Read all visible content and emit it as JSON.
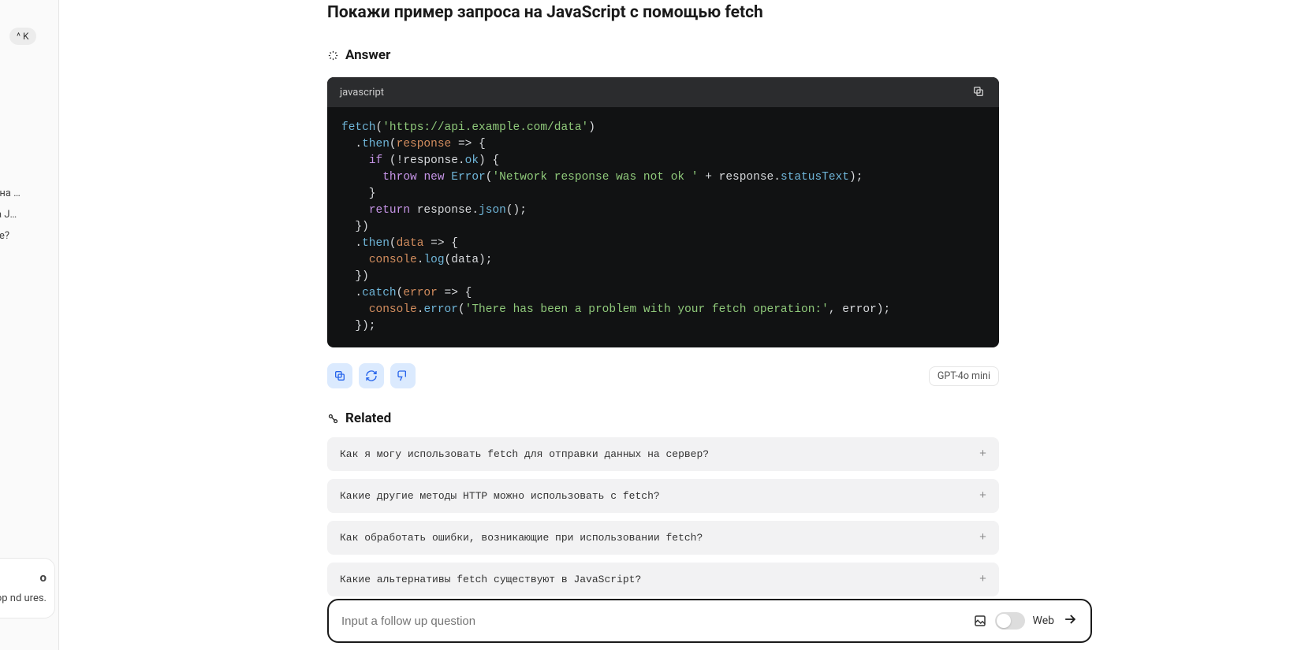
{
  "sidebar": {
    "kbd_shortcut_mod": "^",
    "kbd_shortcut_key": "K",
    "history": [
      "проса на …",
      "осы на J…",
      "ожение?"
    ],
    "promo": {
      "title": "o",
      "text": "top nd ures."
    }
  },
  "page": {
    "title": "Покажи пример запроса на JavaScript с помощью fetch"
  },
  "answer": {
    "heading": "Answer",
    "code_lang": "javascript",
    "code_tokens": [
      [
        [
          "fn",
          "fetch"
        ],
        [
          "punc",
          "("
        ],
        [
          "str",
          "'https://api.example.com/data'"
        ],
        [
          "punc",
          ")"
        ]
      ],
      [
        [
          "punc",
          "  ."
        ],
        [
          "fn",
          "then"
        ],
        [
          "punc",
          "("
        ],
        [
          "id",
          "response"
        ],
        [
          "punc",
          " "
        ],
        [
          "op",
          "=>"
        ],
        [
          "punc",
          " {"
        ]
      ],
      [
        [
          "punc",
          "    "
        ],
        [
          "kw",
          "if"
        ],
        [
          "punc",
          " (!response."
        ],
        [
          "prop",
          "ok"
        ],
        [
          "punc",
          ") {"
        ]
      ],
      [
        [
          "punc",
          "      "
        ],
        [
          "kw",
          "throw"
        ],
        [
          "punc",
          " "
        ],
        [
          "kw",
          "new"
        ],
        [
          "punc",
          " "
        ],
        [
          "fn",
          "Error"
        ],
        [
          "punc",
          "("
        ],
        [
          "str",
          "'Network response was not ok '"
        ],
        [
          "punc",
          " + response."
        ],
        [
          "prop",
          "statusText"
        ],
        [
          "punc",
          ");"
        ]
      ],
      [
        [
          "punc",
          "    }"
        ]
      ],
      [
        [
          "punc",
          "    "
        ],
        [
          "kw",
          "return"
        ],
        [
          "punc",
          " response."
        ],
        [
          "fn",
          "json"
        ],
        [
          "punc",
          "();"
        ]
      ],
      [
        [
          "punc",
          "  })"
        ]
      ],
      [
        [
          "punc",
          "  ."
        ],
        [
          "fn",
          "then"
        ],
        [
          "punc",
          "("
        ],
        [
          "id",
          "data"
        ],
        [
          "punc",
          " "
        ],
        [
          "op",
          "=>"
        ],
        [
          "punc",
          " {"
        ]
      ],
      [
        [
          "punc",
          "    "
        ],
        [
          "id",
          "console"
        ],
        [
          "punc",
          "."
        ],
        [
          "fn",
          "log"
        ],
        [
          "punc",
          "(data);"
        ]
      ],
      [
        [
          "punc",
          "  })"
        ]
      ],
      [
        [
          "punc",
          "  ."
        ],
        [
          "fn",
          "catch"
        ],
        [
          "punc",
          "("
        ],
        [
          "id",
          "error"
        ],
        [
          "punc",
          " "
        ],
        [
          "op",
          "=>"
        ],
        [
          "punc",
          " {"
        ]
      ],
      [
        [
          "punc",
          "    "
        ],
        [
          "id",
          "console"
        ],
        [
          "punc",
          "."
        ],
        [
          "fn",
          "error"
        ],
        [
          "punc",
          "("
        ],
        [
          "str",
          "'There has been a problem with your fetch operation:'"
        ],
        [
          "punc",
          ", error);"
        ]
      ],
      [
        [
          "punc",
          "  });"
        ]
      ]
    ]
  },
  "actions": {
    "model_badge": "GPT-4o mini"
  },
  "related": {
    "heading": "Related",
    "items": [
      "Как я могу использовать fetch для отправки данных на сервер?",
      "Какие другие методы HTTP можно использовать с fetch?",
      "Как обработать ошибки, возникающие при использовании fetch?",
      "Какие альтернативы fetch существуют в JavaScript?"
    ]
  },
  "followup": {
    "placeholder": "Input a follow up question",
    "web_label": "Web"
  }
}
